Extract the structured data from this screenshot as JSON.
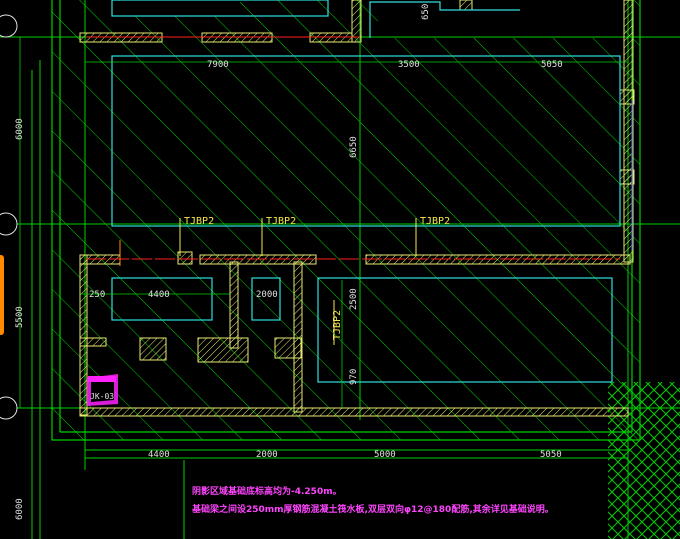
{
  "drawing": {
    "dims_top": [
      "7900",
      "3500",
      "5050",
      "650"
    ],
    "dims_left": [
      "6000",
      "5500",
      "6000"
    ],
    "dims_inner": [
      "250",
      "4400",
      "2000",
      "6650",
      "2500",
      "970"
    ],
    "dims_bottom": [
      "4400",
      "2000",
      "5000",
      "5050"
    ],
    "beam_labels": [
      "TJBP2",
      "TJBP2",
      "TJBP2",
      "TJBP2"
    ],
    "pit_label": "JK-03",
    "notes": [
      "阴影区域基础底标高均为-4.250m。",
      "基础梁之间设250mm厚钢筋混凝土筏水板,双层双向φ12@180配筋,其余详见基础说明。"
    ],
    "colors": {
      "background": "#000000",
      "axis_grid": "#00d000",
      "hatch_wall": "#e8e870",
      "slab_outline": "#30e0e0",
      "dimension_text": "#e0e0e0",
      "beam_label": "#f5e94a",
      "pit_marker": "#ff22ff",
      "note_text": "#ff44ff",
      "red_line": "#ff2020",
      "tab": "#ff8a00"
    }
  }
}
